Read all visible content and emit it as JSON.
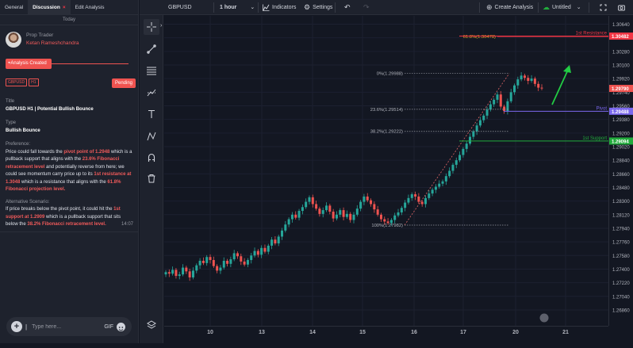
{
  "tabs": [
    {
      "label": "General"
    },
    {
      "label": "Discussion",
      "close": "×"
    },
    {
      "label": "Edit Analysis"
    }
  ],
  "today_label": "Today",
  "author": {
    "role": "Prop Trader",
    "name": "Ketan Rameshchandra"
  },
  "analysis_created": "Analysis Created",
  "badges": [
    "GBPUSD",
    "H1"
  ],
  "status": "Pending",
  "title_label": "Title",
  "title_value": "GBPUSD H1 | Potential Bullish Bounce",
  "type_label": "Type",
  "type_value": "Bullish Bounce",
  "preference_label": "Preference:",
  "preference": [
    {
      "t": "Price could fall towards the "
    },
    {
      "t": "pivot point of 1.2948",
      "h": true
    },
    {
      "t": " which is a pullback support that aligns with the "
    },
    {
      "t": "23.6% Fibonacci retracement level",
      "h": true
    },
    {
      "t": " and potentially reverse from here; we could see momentum carry price up to its "
    },
    {
      "t": "1st resistance at 1.3048",
      "h": true
    },
    {
      "t": " which is a resistance that aligns with the "
    },
    {
      "t": "61.8% Fibonacci projection level.",
      "h": true
    }
  ],
  "alternative_label": "Alternative Scenario:",
  "alternative": [
    {
      "t": "If price breaks below the pivot point, it could hit the "
    },
    {
      "t": "1st support at 1.2909",
      "h": true
    },
    {
      "t": " which is a pullback support that sits below the "
    },
    {
      "t": "38.2% Fibonacci retracement level.",
      "h": true
    }
  ],
  "time": "14:07",
  "chat": {
    "placeholder": "Type here...",
    "gif": "GIF"
  },
  "topbar": {
    "symbol": "GBPUSD",
    "interval": "1 hour",
    "indicators": "Indicators",
    "settings": "Settings",
    "create_analysis": "Create Analysis",
    "layout_name": "Untitled"
  },
  "chart_data": {
    "type": "candlestick",
    "symbol": "GBPUSD",
    "interval": "1 hour",
    "ylim": [
      1.2665,
      1.3075
    ],
    "price_ticks": [
      "1.30640",
      "1.30460",
      "1.30280",
      "1.30100",
      "1.29920",
      "1.29740",
      "1.29560",
      "1.29380",
      "1.29200",
      "1.29020",
      "1.28840",
      "1.28660",
      "1.28480",
      "1.28300",
      "1.28120",
      "1.27940",
      "1.27760",
      "1.27580",
      "1.27400",
      "1.27220",
      "1.27040",
      "1.26860"
    ],
    "x_ticks": [
      {
        "label": "10",
        "day": 10
      },
      {
        "label": "13",
        "day": 13
      },
      {
        "label": "14",
        "day": 14
      },
      {
        "label": "15",
        "day": 15
      },
      {
        "label": "16",
        "day": 16
      },
      {
        "label": "17",
        "day": 17
      },
      {
        "label": "20",
        "day": 20
      },
      {
        "label": "21",
        "day": 21
      }
    ],
    "levels": [
      {
        "label": "1st Resistance",
        "price": 1.30482,
        "price_label": "1.30482",
        "color": "#f23645"
      },
      {
        "label": "Pivot",
        "price": 1.29488,
        "price_label": "1.29488",
        "color": "#7b68ee"
      },
      {
        "label": "1st Support",
        "price": 1.29094,
        "price_label": "1.29094",
        "color": "#22ab3c"
      }
    ],
    "fib": [
      {
        "label": "0%(1.29988)",
        "price": 1.29988
      },
      {
        "label": "23.6%(1.29514)",
        "price": 1.29514
      },
      {
        "label": "38.2%(1.29222)",
        "price": 1.29222
      },
      {
        "label": "100%(1.27982)",
        "price": 1.27982
      }
    ],
    "projection": {
      "label": "61.8%(1.30478)",
      "price": 1.30478
    },
    "current_price": {
      "value": 1.2979,
      "label": "1.29790"
    },
    "closes": [
      1.2736,
      1.2734,
      1.2739,
      1.2731,
      1.2733,
      1.2742,
      1.2737,
      1.2729,
      1.2738,
      1.2745,
      1.2751,
      1.2748,
      1.2756,
      1.2752,
      1.2744,
      1.2738,
      1.2742,
      1.2751,
      1.2747,
      1.2753,
      1.2761,
      1.2757,
      1.275,
      1.2746,
      1.2752,
      1.2758,
      1.2764,
      1.2759,
      1.2768,
      1.2763,
      1.2771,
      1.2779,
      1.2774,
      1.2783,
      1.2791,
      1.2799,
      1.2806,
      1.2812,
      1.2808,
      1.2817,
      1.2822,
      1.2829,
      1.2835,
      1.2826,
      1.282,
      1.2813,
      1.2818,
      1.2824,
      1.2816,
      1.2807,
      1.2812,
      1.2818,
      1.2809,
      1.2813,
      1.2805,
      1.2812,
      1.282,
      1.2829,
      1.2836,
      1.2831,
      1.2826,
      1.2819,
      1.2812,
      1.2806,
      1.2803,
      1.2801,
      1.2805,
      1.2811,
      1.2815,
      1.2821,
      1.2828,
      1.2834,
      1.2839,
      1.2836,
      1.2829,
      1.2826,
      1.2834,
      1.284,
      1.2845,
      1.2849,
      1.2853,
      1.2856,
      1.2863,
      1.287,
      1.2878,
      1.2884,
      1.2891,
      1.2899,
      1.2906,
      1.2915,
      1.2922,
      1.293,
      1.2937,
      1.2943,
      1.2951,
      1.2958,
      1.2964,
      1.2971,
      1.2955,
      1.2949,
      1.2962,
      1.2974,
      1.2983,
      1.2991,
      1.2996,
      1.2993,
      1.2989,
      1.2992,
      1.2985,
      1.298,
      1.2979
    ]
  }
}
